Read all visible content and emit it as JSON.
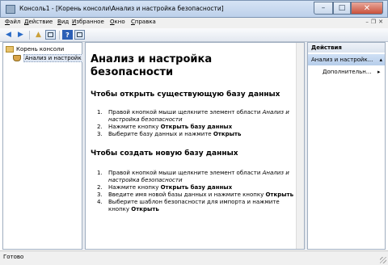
{
  "window": {
    "title": "Консоль1 - [Корень консоли\\Анализ и настройка безопасности]",
    "minimize_icon": "minimize-icon",
    "maximize_icon": "maximize-icon",
    "close_icon": "close-icon"
  },
  "menubar": {
    "items": [
      "Файл",
      "Действие",
      "Вид",
      "Избранное",
      "Окно",
      "Справка"
    ]
  },
  "toolbar": {
    "buttons": [
      "back-arrow-icon",
      "forward-arrow-icon",
      "up-folder-icon",
      "show-hide-tree-icon",
      "help-icon",
      "properties-icon"
    ]
  },
  "tree": {
    "root": "Корень консоли",
    "child": "Анализ и настройк"
  },
  "content": {
    "heading": "Анализ и настройка безопасности",
    "open_title": "Чтобы открыть существующую базу данных",
    "open_steps": {
      "s1_num": "1.",
      "s1_a": "Правой кнопкой мыши щелкните элемент области ",
      "s1_b": "Анализ и настройка безопасности",
      "s2_num": "2.",
      "s2_a": "Нажмите кнопку ",
      "s2_b": "Открыть базу данных",
      "s3_num": "3.",
      "s3_a": "Выберите базу данных и нажмите ",
      "s3_b": "Открыть"
    },
    "create_title": "Чтобы создать новую базу данных",
    "create_steps": {
      "s1_num": "1.",
      "s1_a": "Правой кнопкой мыши щелкните элемент области ",
      "s1_b": "Анализ и настройка безопасности",
      "s2_num": "2.",
      "s2_a": "Нажмите кнопку ",
      "s2_b": "Открыть базу данных",
      "s3_num": "3.",
      "s3_a": "Введите имя новой базы данных и нажмите кнопку ",
      "s3_b": "Открыть",
      "s4_num": "4.",
      "s4_a": "Выберите шаблон безопасности для импорта и нажмите кнопку ",
      "s4_b": "Открыть"
    }
  },
  "actions": {
    "title": "Действия",
    "group": "Анализ и настройк...",
    "item": "Дополнительн...",
    "group_arrow": "▴",
    "item_arrow": "▸"
  },
  "status": {
    "text": "Готово"
  }
}
